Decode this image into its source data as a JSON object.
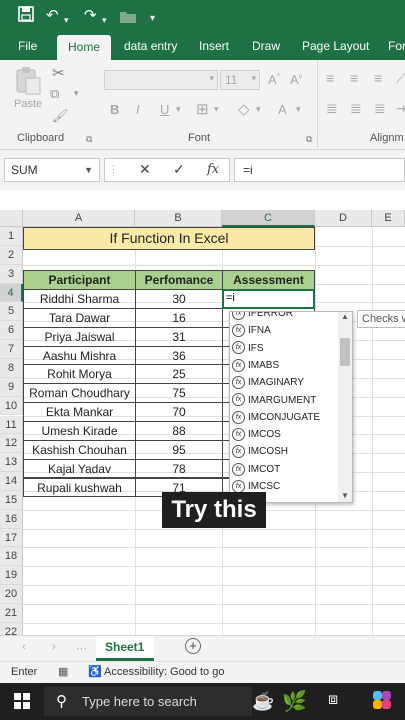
{
  "quick_access": {
    "save_icon": "save-icon",
    "undo_icon": "undo-icon",
    "redo_icon": "redo-icon",
    "folder_icon": "folder-icon",
    "customize_icon": "customize-icon"
  },
  "ribbon": {
    "tabs": [
      "File",
      "Home",
      "data entry",
      "Insert",
      "Draw",
      "Page Layout",
      "For"
    ],
    "active_tab": "Home",
    "groups": {
      "clipboard": "Clipboard",
      "font": "Font",
      "alignment": "Alignm"
    },
    "paste_label": "Paste",
    "font_size": "11",
    "bold": "B",
    "italic": "I",
    "underline": "U"
  },
  "formula_bar": {
    "name_box": "SUM",
    "cancel": "✕",
    "enter": "✓",
    "fx": "fx",
    "formula": "=i"
  },
  "sheet": {
    "columns": [
      "A",
      "B",
      "C",
      "D",
      "E"
    ],
    "rows": [
      "1",
      "2",
      "3",
      "4",
      "5",
      "6",
      "7",
      "8",
      "9",
      "10",
      "11",
      "12",
      "13",
      "14",
      "15",
      "16",
      "17",
      "18",
      "19",
      "20",
      "21",
      "22"
    ],
    "title": "If Function In Excel",
    "headers": [
      "Participant",
      "Perfomance",
      "Assessment"
    ],
    "data": [
      [
        "Riddhi Sharma",
        "30"
      ],
      [
        "Tara Dawar",
        "16"
      ],
      [
        "Priya Jaiswal",
        "31"
      ],
      [
        "Aashu Mishra",
        "36"
      ],
      [
        "Rohit Morya",
        "25"
      ],
      [
        "Roman Choudhary",
        "75"
      ],
      [
        "Ekta Mankar",
        "70"
      ],
      [
        "Umesh Kirade",
        "88"
      ],
      [
        "Kashish Chouhan",
        "95"
      ],
      [
        "Kajal Yadav",
        "78"
      ],
      [
        "Rupali kushwah",
        "71"
      ]
    ],
    "active_cell_value": "=i"
  },
  "autocomplete": {
    "items": [
      "IFERROR",
      "IFNA",
      "IFS",
      "IMABS",
      "IMAGINARY",
      "IMARGUMENT",
      "IMCONJUGATE",
      "IMCOS",
      "IMCOSH",
      "IMCOT",
      "IMCSC"
    ],
    "tooltip": "Checks w"
  },
  "overlay_caption": "Try this",
  "sheet_tabs": {
    "active": "Sheet1",
    "add": "+"
  },
  "status": {
    "mode": "Enter",
    "accessibility": "Accessibility: Good to go"
  },
  "taskbar": {
    "search_placeholder": "Type here to search"
  }
}
